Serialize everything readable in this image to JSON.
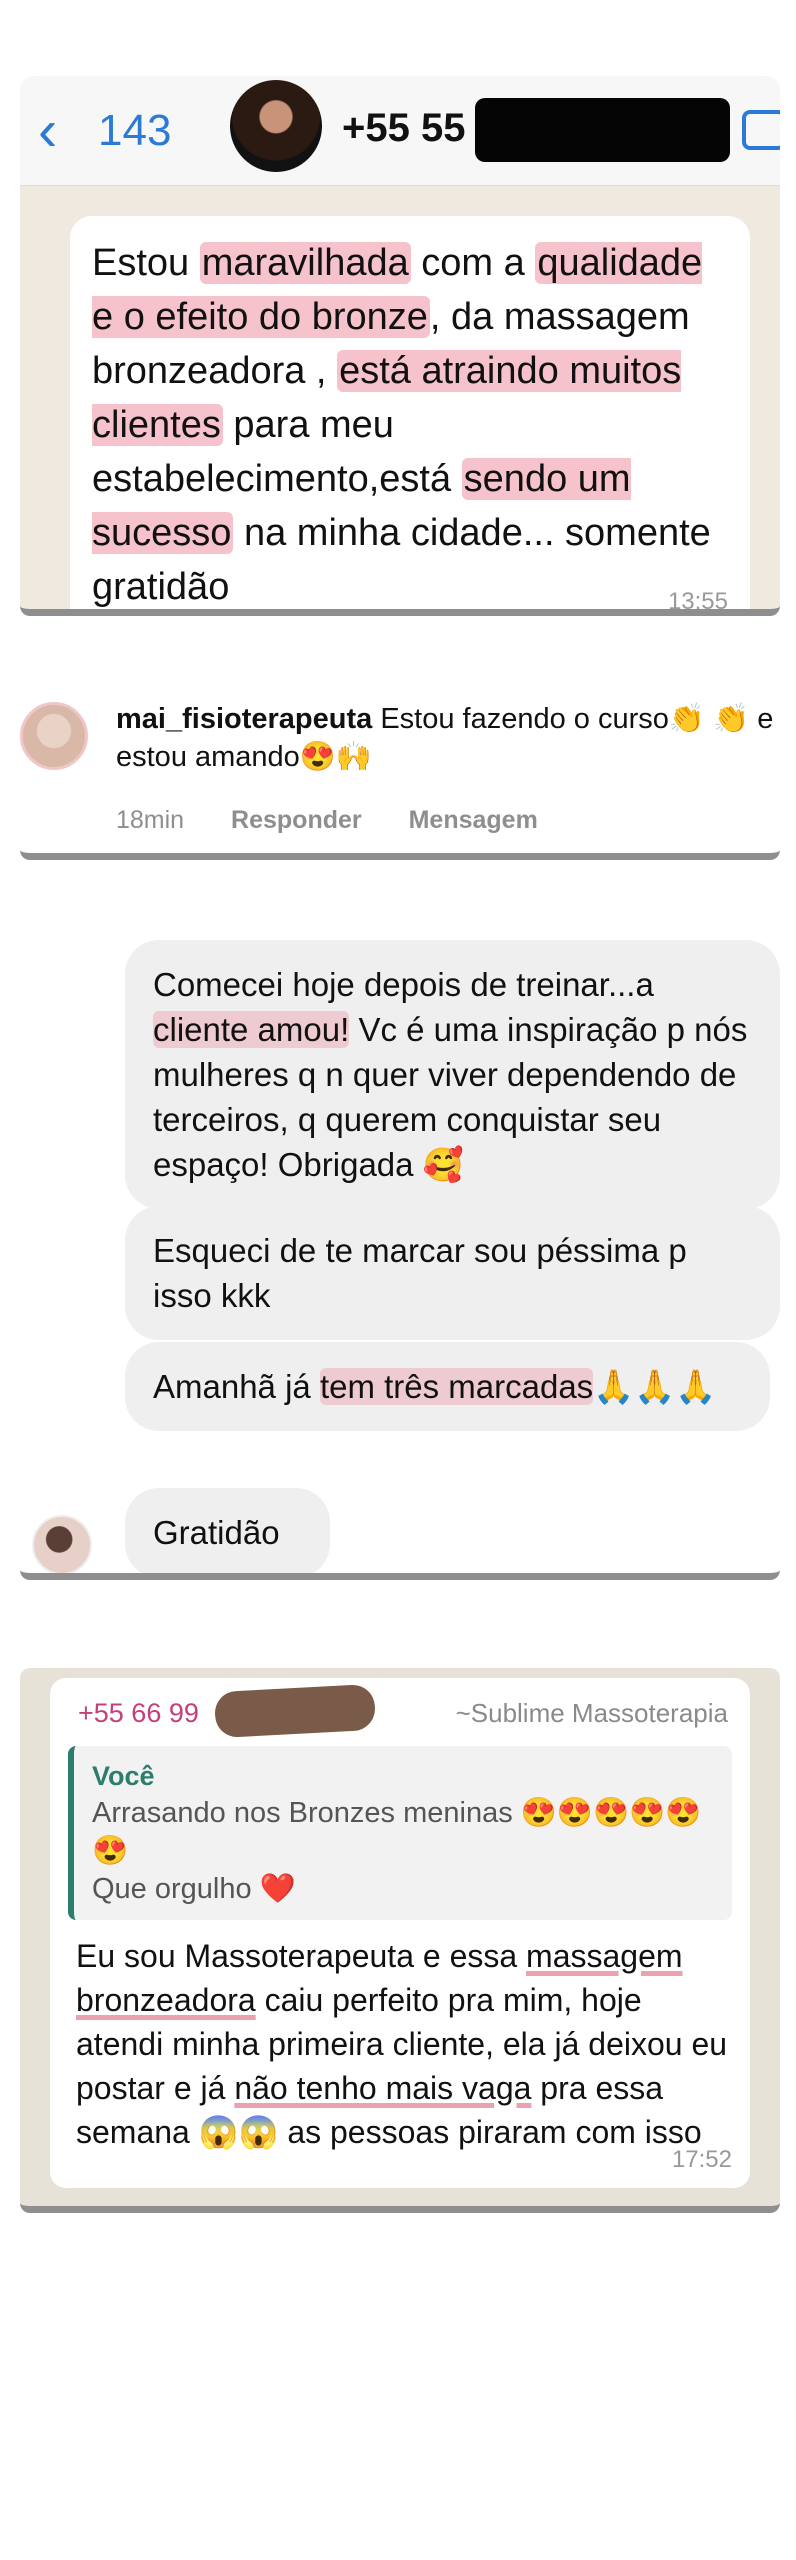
{
  "card1": {
    "back_count": "143",
    "contact_number": "+55 55",
    "message": {
      "p1": "Estou ",
      "hl1": "maravilhada",
      "p2": " com a ",
      "hl2": "qualidade e o efeito do bronze",
      "p3": ", da massagem bronzeadora , ",
      "hl3": "está atraindo muitos clientes",
      "p4": " para meu estabelecimento,está ",
      "hl4": "sendo um sucesso",
      "p5": " na minha cidade... somente gratidão"
    },
    "time": "13:55"
  },
  "card2": {
    "username": "mai_fisioterapeuta",
    "comment": " Estou fazendo o curso👏 👏 e estou amando😍🙌",
    "age": "18min",
    "reply": "Responder",
    "message_link": "Mensagem"
  },
  "card3": {
    "msg1": {
      "t1": "Comecei hoje depois de treinar...a ",
      "hl": "cliente amou!",
      "t2": " Vc é uma inspiração p nós mulheres q n quer viver dependendo de terceiros, q querem conquistar seu espaço! Obrigada 🥰"
    },
    "msg2": "Esqueci de te marcar sou péssima p isso kkk",
    "msg3": {
      "t1": "Amanhã já ",
      "hl": "tem três marcadas",
      "t2": "🙏🙏🙏"
    },
    "msg4": "Gratidão"
  },
  "card4": {
    "sender": "+55 66 99",
    "group": "~Sublime Massoterapia",
    "quote_name": "Você",
    "quote_line1": "Arrasando nos Bronzes meninas 😍😍😍😍😍😍",
    "quote_line2": "Que orgulho ❤️",
    "body": {
      "t1": "Eu sou Massoterapeuta e essa ",
      "u1": "massagem bronzeadora",
      "t2": " caiu perfeito pra mim, hoje atendi minha primeira cliente, ela já deixou eu postar e já ",
      "u2": "não tenho mais vaga",
      "t3": " pra essa semana 😱😱 as pessoas piraram com isso"
    },
    "time": "17:52"
  }
}
